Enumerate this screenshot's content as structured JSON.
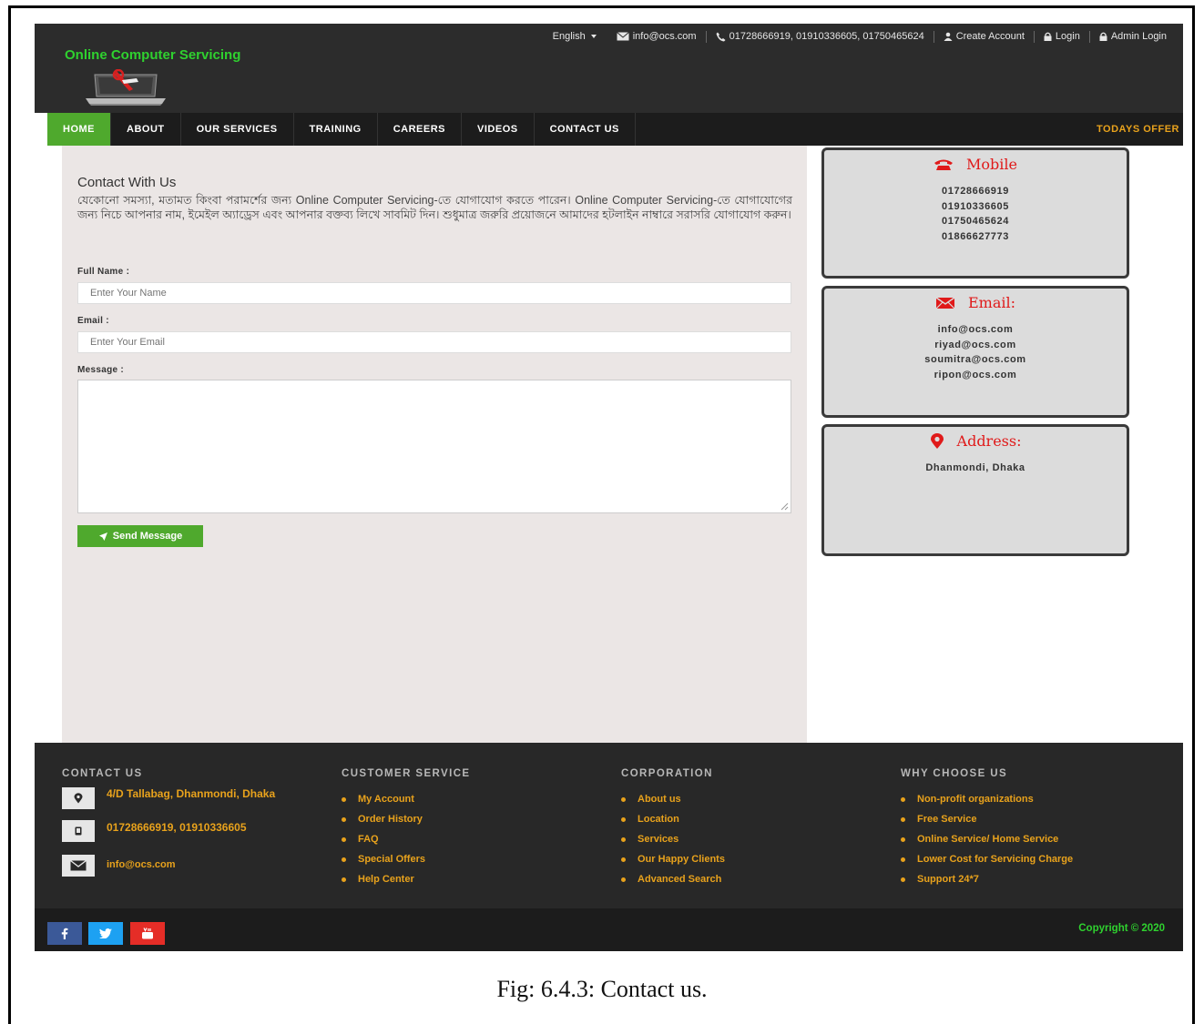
{
  "topbar": {
    "language": "English",
    "email": "info@ocs.com",
    "phones": "01728666919, 01910336605, 01750465624",
    "create_account": "Create Account",
    "login": "Login",
    "admin_login": "Admin Login"
  },
  "brand": {
    "name": "Online Computer Servicing"
  },
  "nav": {
    "items": [
      {
        "label": "HOME",
        "active": true
      },
      {
        "label": "ABOUT"
      },
      {
        "label": "OUR SERVICES"
      },
      {
        "label": "TRAINING"
      },
      {
        "label": "CAREERS"
      },
      {
        "label": "VIDEOS"
      },
      {
        "label": "CONTACT US"
      }
    ],
    "offer": "TODAYS OFFER"
  },
  "contact": {
    "title": "Contact With Us",
    "description": "যেকোনো সমস্যা, মতামত কিংবা পরামর্শের জন্য Online Computer Servicing-তে যোগাযোগ করতে পারেন। Online Computer Servicing-তে যোগাযোগের জন্য নিচে আপনার নাম, ইমেইল অ্যাড্রেস এবং আপনার বক্তব্য লিখে সাবমিট দিন। শুধুমাত্র জরুরি প্রয়োজনে আমাদের হটলাইন নাম্বারে সরাসরি যোগাযোগ করুন।",
    "fullname_label": "Full Name :",
    "fullname_placeholder": "Enter Your Name",
    "email_label": "Email :",
    "email_placeholder": "Enter Your Email",
    "message_label": "Message :",
    "send_label": "Send Message"
  },
  "info": {
    "mobile": {
      "title": "Mobile",
      "lines": [
        "01728666919",
        "01910336605",
        "01750465624",
        "01866627773"
      ]
    },
    "email": {
      "title": "Email:",
      "lines": [
        "info@ocs.com",
        "riyad@ocs.com",
        "soumitra@ocs.com",
        "ripon@ocs.com"
      ]
    },
    "address": {
      "title": "Address:",
      "lines": [
        "Dhanmondi, Dhaka"
      ]
    }
  },
  "footer": {
    "contact": {
      "heading": "CONTACT US",
      "address": "4/D Tallabag, Dhanmondi, Dhaka",
      "phones": "01728666919, 01910336605",
      "email": "info@ocs.com"
    },
    "customer_service": {
      "heading": "CUSTOMER SERVICE",
      "items": [
        "My Account",
        "Order History",
        "FAQ",
        "Special Offers",
        "Help Center"
      ]
    },
    "corporation": {
      "heading": "CORPORATION",
      "items": [
        "About us",
        "Location",
        "Services",
        "Our Happy Clients",
        "Advanced Search"
      ]
    },
    "why": {
      "heading": "WHY CHOOSE US",
      "items": [
        "Non-profit organizations",
        "Free Service",
        "Online Service/ Home Service",
        "Lower Cost for Servicing Charge",
        "Support 24*7"
      ]
    },
    "copyright": "Copyright © 2020"
  },
  "caption": "Fig: 6.4.3:  Contact us.",
  "colors": {
    "accent_green": "#4fa92d",
    "brand_green": "#2fd12f",
    "link_orange": "#e8a21c",
    "info_red": "#e01a1a"
  }
}
